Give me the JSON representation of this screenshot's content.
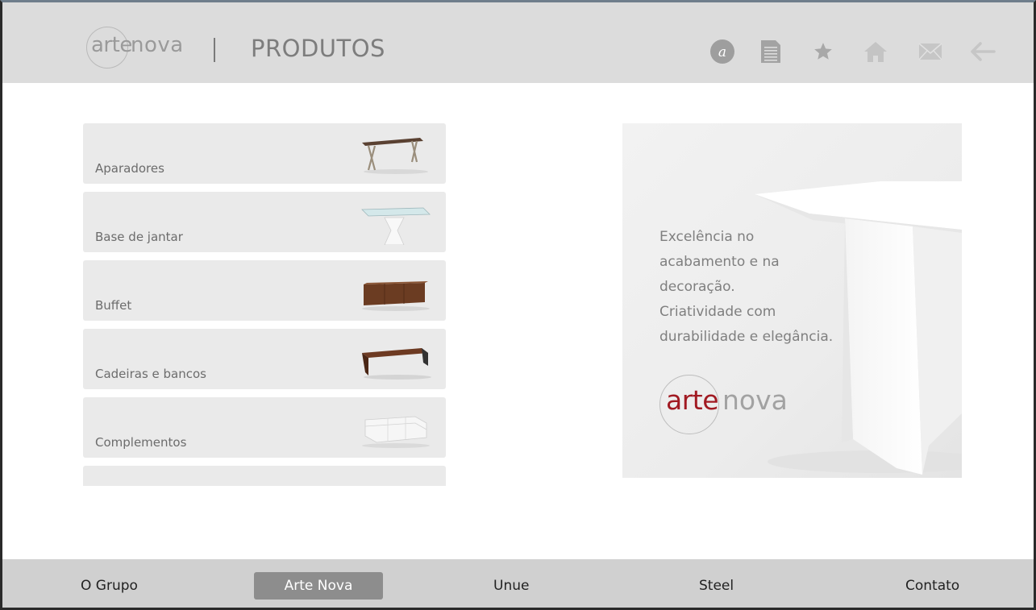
{
  "header": {
    "logo": {
      "word1": "arte",
      "word2": "nova"
    },
    "title": "PRODUTOS",
    "icons": [
      {
        "name": "a-circle-icon"
      },
      {
        "name": "document-icon"
      },
      {
        "name": "star-icon"
      },
      {
        "name": "home-icon"
      },
      {
        "name": "mail-icon"
      },
      {
        "name": "back-arrow-icon"
      }
    ]
  },
  "products": [
    {
      "label": "Aparadores",
      "thumb": "sideboard-table"
    },
    {
      "label": "Base de jantar",
      "thumb": "glass-dining-table"
    },
    {
      "label": "Buffet",
      "thumb": "wood-buffet"
    },
    {
      "label": "Cadeiras e bancos",
      "thumb": "wood-bench"
    },
    {
      "label": "Complementos",
      "thumb": "white-sofa"
    },
    {
      "label": "",
      "thumb": "partial-item"
    }
  ],
  "promo": {
    "lines": [
      "Excelência no",
      "acabamento e na",
      "decoração.",
      "Criatividade com",
      "durabilidade e elegância."
    ],
    "logo": {
      "word1": "arte",
      "word2": "nova"
    },
    "colors": {
      "logo_red": "#a11a22"
    }
  },
  "footer": {
    "items": [
      {
        "label": "O Grupo",
        "active": false
      },
      {
        "label": "Arte Nova",
        "active": true
      },
      {
        "label": "Unue",
        "active": false
      },
      {
        "label": "Steel",
        "active": false
      },
      {
        "label": "Contato",
        "active": false
      }
    ]
  }
}
